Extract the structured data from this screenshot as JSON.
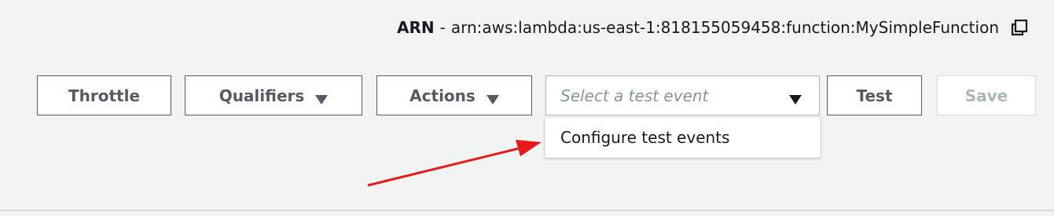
{
  "arn": {
    "label": "ARN",
    "separator": "-",
    "value": "arn:aws:lambda:us-east-1:818155059458:function:MySimpleFunction",
    "copy_icon": "copy-icon"
  },
  "toolbar": {
    "throttle_label": "Throttle",
    "qualifiers_label": "Qualifiers",
    "actions_label": "Actions",
    "test_event_placeholder": "Select a test event",
    "test_label": "Test",
    "save_label": "Save"
  },
  "dropdown": {
    "items": [
      {
        "label": "Configure test events"
      }
    ]
  },
  "colors": {
    "background": "#f2f3f3",
    "button_border": "#545b64",
    "disabled": "#aab7b8",
    "annotation_arrow": "#e8191a"
  }
}
